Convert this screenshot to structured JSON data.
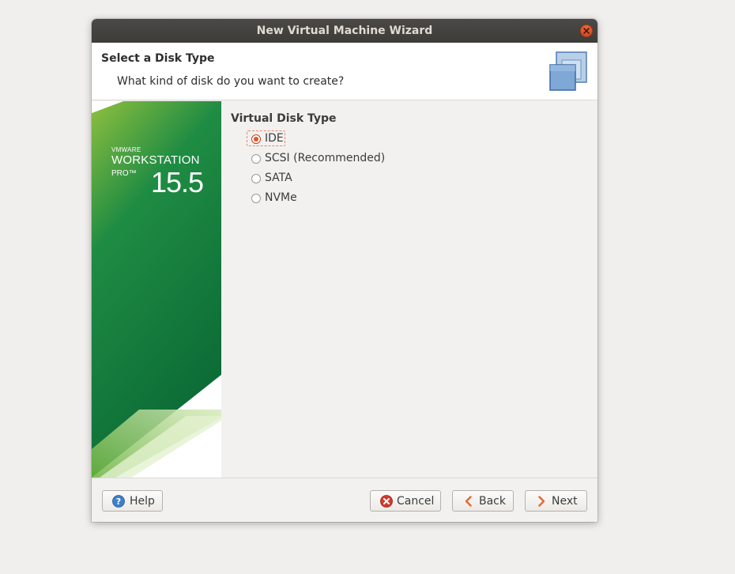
{
  "window": {
    "title": "New Virtual Machine Wizard"
  },
  "header": {
    "title": "Select a Disk Type",
    "subtitle": "What kind of disk do you want to create?",
    "icon": "stacked-disks-icon"
  },
  "banner": {
    "brand_small": "VMWARE",
    "brand_product": "WORKSTATION",
    "brand_edition": "PRO™",
    "brand_version": "15.5"
  },
  "disk_type": {
    "section_title": "Virtual Disk Type",
    "options": [
      {
        "label": "IDE",
        "selected": true
      },
      {
        "label": "SCSI (Recommended)",
        "selected": false
      },
      {
        "label": "SATA",
        "selected": false
      },
      {
        "label": "NVMe",
        "selected": false
      }
    ]
  },
  "buttons": {
    "help": "Help",
    "cancel": "Cancel",
    "back": "Back",
    "next": "Next"
  },
  "colors": {
    "titlebar": "#3d3c38",
    "accent": "#e95420",
    "banner_green": "#0f7a3e"
  }
}
